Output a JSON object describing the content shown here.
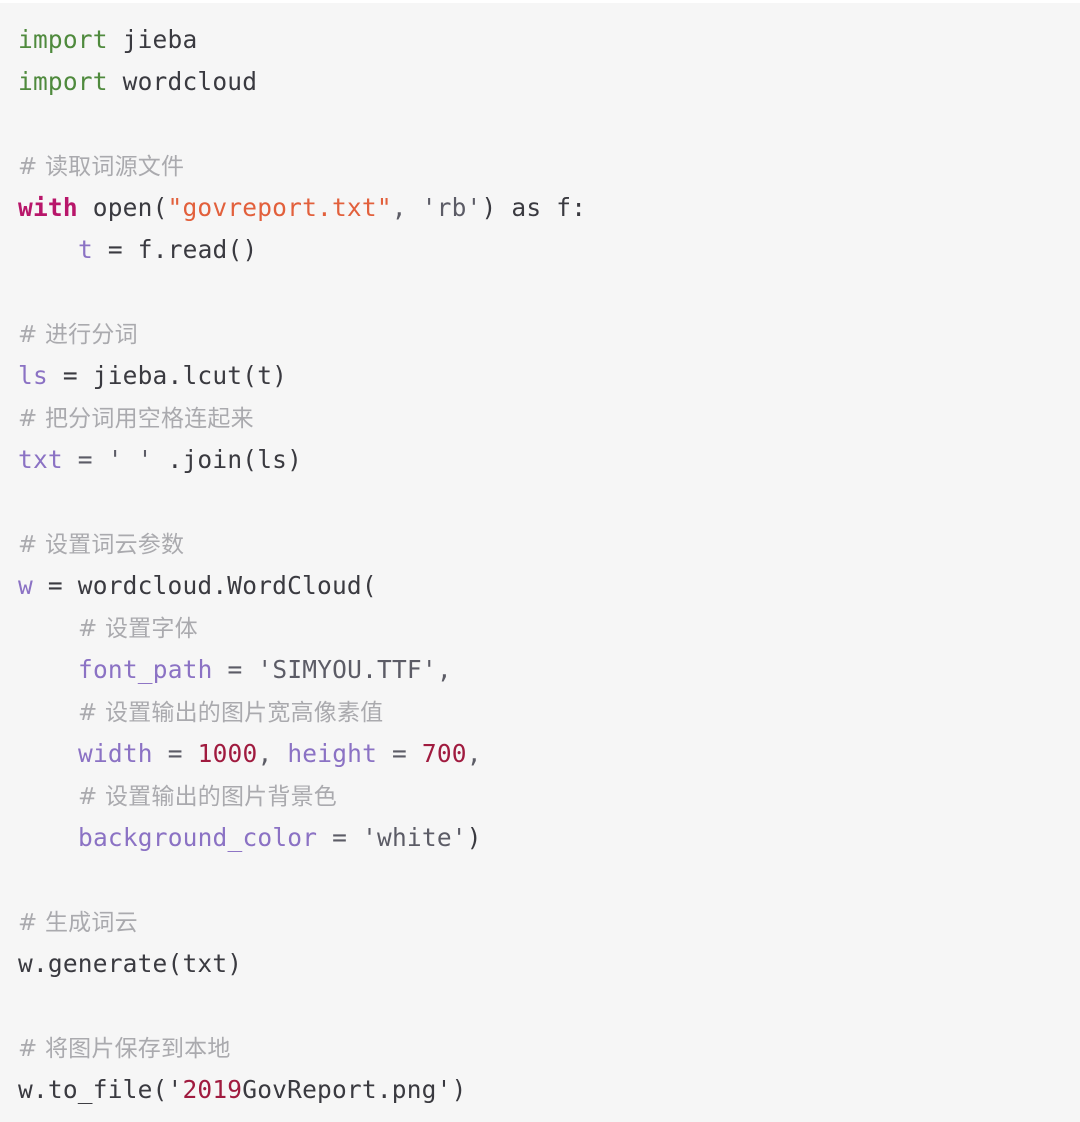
{
  "editor": {
    "language": "python",
    "background_color": "#f6f6f6",
    "syntax_colors": {
      "keyword_import": "#4f8a3d",
      "keyword_with": "#b8166a",
      "variable": "#8b72c4",
      "parameter": "#8b72c4",
      "string_highlight": "#e2603c",
      "string": "#5c5c66",
      "number": "#a01b3f",
      "comment": "#aaaaae",
      "default_text": "#3a3a40"
    }
  },
  "code": {
    "line_01": {
      "kw": "import",
      "rest": " jieba"
    },
    "line_02": {
      "kw": "import",
      "rest": " wordcloud"
    },
    "line_03": "",
    "line_04": {
      "comment": "# 读取词源文件"
    },
    "line_05": {
      "kw": "with",
      "call": " open(",
      "str1": "\"govreport.txt\"",
      "sep": ", ",
      "str2": "'rb'",
      "tail": ") as f:"
    },
    "line_06": {
      "var": "t",
      "rest": " = f.read()"
    },
    "line_07": "",
    "line_08": {
      "comment": "# 进行分词"
    },
    "line_09": {
      "var": "ls",
      "rest": " = jieba.lcut(t)"
    },
    "line_10": {
      "comment": "# 把分词用空格连起来"
    },
    "line_11": {
      "var": "txt",
      "eq": " = ",
      "str": "' '",
      "rest": " .join(ls)"
    },
    "line_12": "",
    "line_13": {
      "comment": "# 设置词云参数"
    },
    "line_14": {
      "var": "w",
      "rest": " = wordcloud.WordCloud("
    },
    "line_15": {
      "comment": "# 设置字体"
    },
    "line_16": {
      "param": "font_path",
      "eq": " = ",
      "str": "'SIMYOU.TTF'",
      "tail": ","
    },
    "line_17": {
      "comment": "# 设置输出的图片宽高像素值"
    },
    "line_18": {
      "param1": "width",
      "eq1": " = ",
      "num1": "1000",
      "sep": ", ",
      "param2": "height",
      "eq2": " = ",
      "num2": "700",
      "tail": ","
    },
    "line_19": {
      "comment": "# 设置输出的图片背景色"
    },
    "line_20": {
      "param": "background_color",
      "eq": " = ",
      "str": "'white'",
      "tail": ")"
    },
    "line_21": "",
    "line_22": {
      "comment": "# 生成词云"
    },
    "line_23": {
      "text": "w.generate(txt)"
    },
    "line_24": "",
    "line_25": {
      "comment": "# 将图片保存到本地"
    },
    "line_26": {
      "prefix": "w.to_file('",
      "num": "2019",
      "str": "GovReport.png",
      "suffix": "')"
    }
  }
}
